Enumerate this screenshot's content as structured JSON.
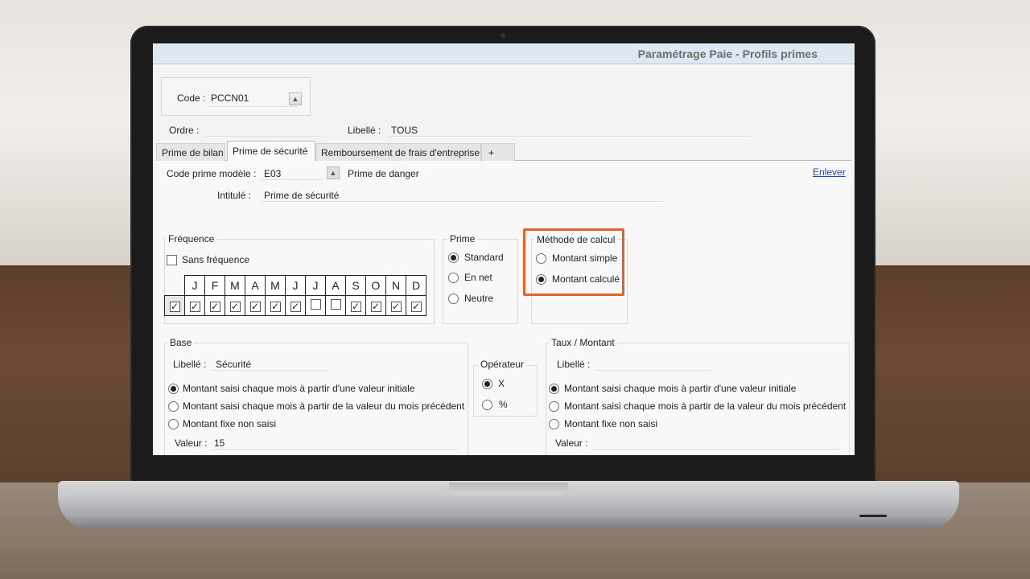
{
  "window": {
    "title": "Paramétrage Paie - Profils primes"
  },
  "code": {
    "label": "Code :",
    "value": "PCCN01"
  },
  "ordre": {
    "label": "Ordre :",
    "value": ""
  },
  "libelle": {
    "label": "Libellé :",
    "value": "TOUS"
  },
  "tabs": [
    {
      "label": "Prime de bilan",
      "active": false
    },
    {
      "label": "Prime de sécurité",
      "active": true
    },
    {
      "label": "Remboursement de frais d'entreprise",
      "active": false
    },
    {
      "label": "+",
      "active": false
    }
  ],
  "prime_form": {
    "code_modele_label": "Code prime modèle :",
    "code_modele_value": "E03",
    "code_modele_desc": "Prime de danger",
    "intitule_label": "Intitulé :",
    "intitule_value": "Prime de sécurité",
    "remove_link": "Enlever"
  },
  "frequence": {
    "title": "Fréquence",
    "sans_frequence_label": "Sans fréquence",
    "sans_frequence_checked": false,
    "months": [
      "J",
      "F",
      "M",
      "A",
      "M",
      "J",
      "J",
      "A",
      "S",
      "O",
      "N",
      "D"
    ],
    "checked": [
      true,
      true,
      true,
      true,
      true,
      true,
      false,
      false,
      true,
      true,
      true,
      true
    ],
    "all_checked": true
  },
  "prime": {
    "title": "Prime",
    "options": [
      "Standard",
      "En net",
      "Neutre"
    ],
    "selected": 0
  },
  "methode": {
    "title": "Méthode de calcul",
    "options": [
      "Montant simple",
      "Montant calculé"
    ],
    "selected": 1,
    "highlight_color": "#e0622d"
  },
  "base": {
    "title": "Base",
    "libelle_label": "Libellé :",
    "libelle_value": "Sécurité",
    "options": [
      "Montant saisi chaque mois à partir d'une valeur initiale",
      "Montant saisi chaque mois à partir de la valeur du mois précédent",
      "Montant fixe non saisi"
    ],
    "selected": 0,
    "valeur_label": "Valeur :",
    "valeur_value": "15"
  },
  "operateur": {
    "title": "Opérateur",
    "options": [
      "X",
      "%"
    ],
    "selected": 0
  },
  "taux": {
    "title": "Taux / Montant",
    "libelle_label": "Libellé :",
    "libelle_value": "",
    "options": [
      "Montant saisi chaque mois à partir d'une valeur initiale",
      "Montant saisi chaque mois à partir de la valeur du mois précédent",
      "Montant fixe non saisi"
    ],
    "selected": 0,
    "valeur_label": "Valeur :",
    "valeur_value": ""
  }
}
